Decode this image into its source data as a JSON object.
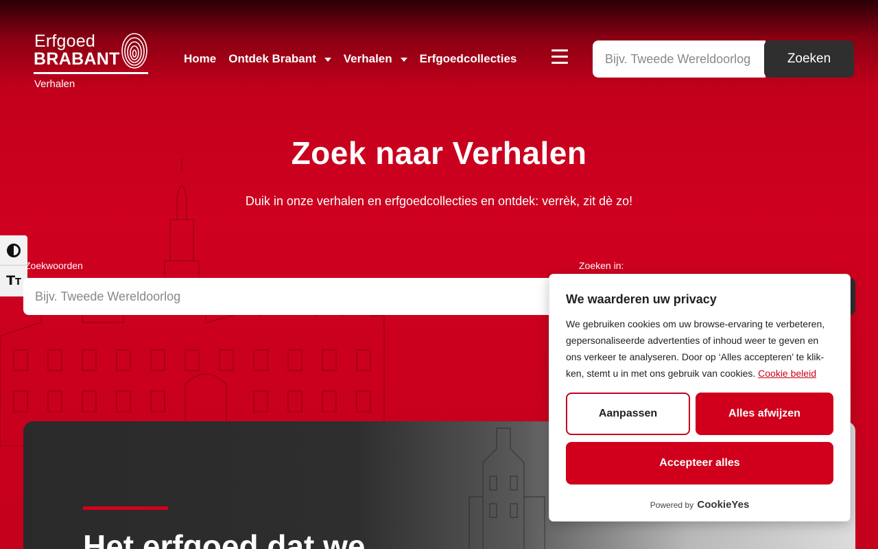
{
  "colors": {
    "brand_red": "#d0001c",
    "dark_button": "#2f2f2f"
  },
  "logo": {
    "line1": "Erfgoed",
    "line2": "BRABANT",
    "line3": "Verhalen",
    "icon": "fingerprint-icon"
  },
  "nav": {
    "items": [
      {
        "label": "Home",
        "dropdown": false
      },
      {
        "label": "Ontdek Brabant",
        "dropdown": true
      },
      {
        "label": "Verhalen",
        "dropdown": true
      },
      {
        "label": "Erfgoedcollecties",
        "dropdown": false
      }
    ],
    "menu_icon": "hamburger-icon"
  },
  "top_search": {
    "placeholder": "Bijv. Tweede Wereldoorlog",
    "button": "Zoeken"
  },
  "hero": {
    "title": "Zoek naar Verhalen",
    "subtitle": "Duik in onze verhalen en erfgoedcollecties en ontdek: verrèk, zit dè zo!"
  },
  "search_form": {
    "keywords_label": "Zoekwoorden",
    "keywords_placeholder": "Bijv. Tweede Wereldoorlog",
    "scope_label": "Zoeken in:"
  },
  "accessibility": {
    "contrast_icon": "contrast-icon",
    "text_size_icon": "text-size-icon"
  },
  "feature": {
    "heading": "Het erfgoed dat we"
  },
  "cookie": {
    "title": "We waarderen uw privacy",
    "body": "We gebruiken cookies om uw browse-ervaring te verbeteren, gepersonaliseerde advertenties of inhoud weer te geven en ons verkeer te analyseren. Door op ‘Alles accepteren’ te klik-ken, stemt u in met ons gebruik van cookies.",
    "policy_link": "Cookie beleid",
    "customize": "Aanpassen",
    "reject": "Alles afwijzen",
    "accept": "Accepteer alles",
    "powered_by": "Powered by",
    "powered_brand": "CookieYes"
  }
}
